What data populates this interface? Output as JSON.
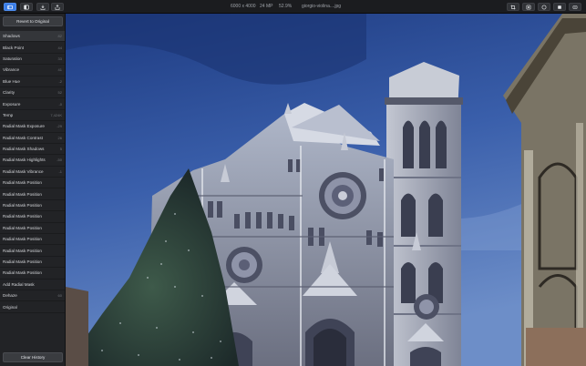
{
  "toolbar": {
    "dimensions": "6000 x 4000",
    "megapixels": "24 MP",
    "zoom": "52.9%",
    "filename": "giorgio-violina....jpg",
    "left_buttons": [
      {
        "name": "adjustments-icon",
        "active": true
      },
      {
        "name": "compare-icon",
        "active": false
      },
      {
        "name": "import-icon",
        "active": false
      },
      {
        "name": "share-icon",
        "active": false
      }
    ],
    "right_buttons": [
      {
        "name": "crop-icon"
      },
      {
        "name": "mask-icon"
      },
      {
        "name": "preset-icon"
      },
      {
        "name": "histogram-icon"
      },
      {
        "name": "more-icon"
      }
    ]
  },
  "sidebar": {
    "revert_label": "Revert to Original",
    "clear_label": "Clear History",
    "history": [
      {
        "label": "Shadows",
        "value": "82",
        "selected": true
      },
      {
        "label": "Black Point",
        "value": "44"
      },
      {
        "label": "Saturation",
        "value": "33"
      },
      {
        "label": "Vibrance",
        "value": "41"
      },
      {
        "label": "Blue Hue",
        "value": "-2"
      },
      {
        "label": "Clarity",
        "value": "52"
      },
      {
        "label": "Exposure",
        "value": "-0"
      },
      {
        "label": "Temp",
        "value": "7,424K"
      },
      {
        "label": "Radial Mask Exposure",
        "value": "-29"
      },
      {
        "label": "Radial Mask Contrast",
        "value": "26"
      },
      {
        "label": "Radial Mask Shadows",
        "value": "5"
      },
      {
        "label": "Radial Mask Highlights",
        "value": "-50"
      },
      {
        "label": "Radial Mask Vibrance",
        "value": "-1"
      },
      {
        "label": "Radial Mask Position",
        "value": ""
      },
      {
        "label": "Radial Mask Position",
        "value": ""
      },
      {
        "label": "Radial Mask Position",
        "value": ""
      },
      {
        "label": "Radial Mask Position",
        "value": ""
      },
      {
        "label": "Radial Mask Position",
        "value": ""
      },
      {
        "label": "Radial Mask Position",
        "value": ""
      },
      {
        "label": "Radial Mask Position",
        "value": ""
      },
      {
        "label": "Radial Mask Position",
        "value": ""
      },
      {
        "label": "Radial Mask Position",
        "value": ""
      },
      {
        "label": "Add Radial Mask",
        "value": ""
      },
      {
        "label": "Dehaze",
        "value": "60"
      },
      {
        "label": "Original",
        "value": ""
      }
    ]
  },
  "colors": {
    "accent": "#3b7de6",
    "sky_top": "#1f3f87",
    "sky_bottom": "#5b7fc4"
  }
}
